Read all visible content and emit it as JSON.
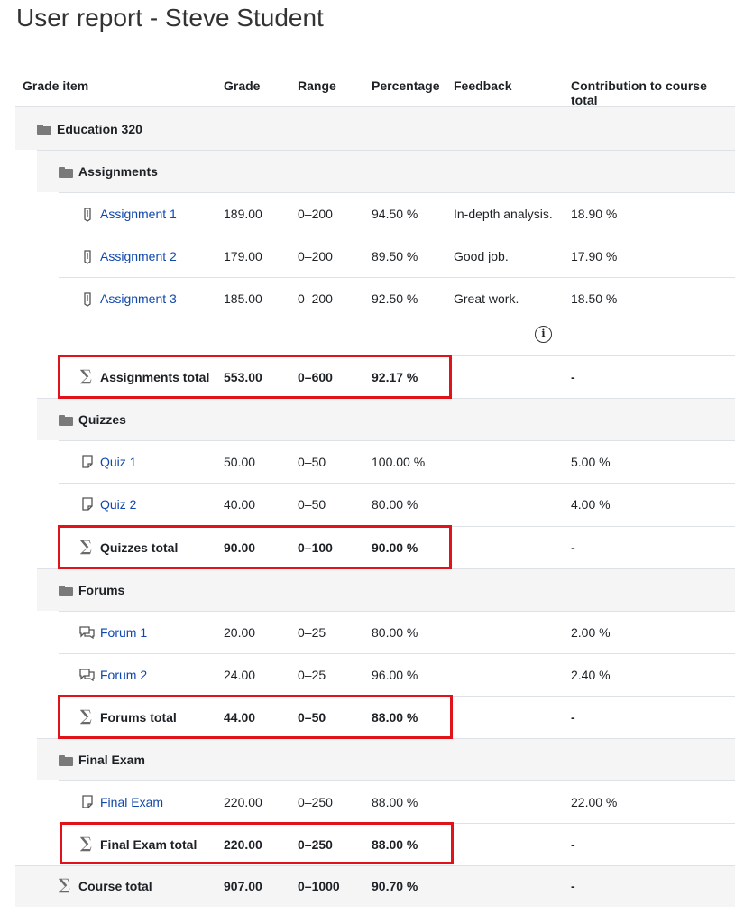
{
  "page": {
    "title": "User report - Steve Student"
  },
  "header": {
    "grade_item": "Grade item",
    "grade": "Grade",
    "range": "Range",
    "percentage": "Percentage",
    "feedback": "Feedback",
    "contribution": "Contribution to course total"
  },
  "course": {
    "name": "Education 320"
  },
  "assignments": {
    "name": "Assignments",
    "items": [
      {
        "name": "Assignment 1",
        "grade": "189.00",
        "range": "0–200",
        "percentage": "94.50 %",
        "feedback": "In-depth analysis.",
        "contribution": "18.90 %"
      },
      {
        "name": "Assignment 2",
        "grade": "179.00",
        "range": "0–200",
        "percentage": "89.50 %",
        "feedback": "Good job.",
        "contribution": "17.90 %"
      },
      {
        "name": "Assignment 3",
        "grade": "185.00",
        "range": "0–200",
        "percentage": "92.50 %",
        "feedback": "Great work.",
        "contribution": "18.50 %"
      }
    ],
    "total": {
      "name": "Assignments total",
      "grade": "553.00",
      "range": "0–600",
      "percentage": "92.17 %",
      "contribution": "-"
    }
  },
  "quizzes": {
    "name": "Quizzes",
    "items": [
      {
        "name": "Quiz 1",
        "grade": "50.00",
        "range": "0–50",
        "percentage": "100.00 %",
        "contribution": "5.00 %"
      },
      {
        "name": "Quiz 2",
        "grade": "40.00",
        "range": "0–50",
        "percentage": "80.00 %",
        "contribution": "4.00 %"
      }
    ],
    "total": {
      "name": "Quizzes total",
      "grade": "90.00",
      "range": "0–100",
      "percentage": "90.00 %",
      "contribution": "-"
    }
  },
  "forums": {
    "name": "Forums",
    "items": [
      {
        "name": "Forum 1",
        "grade": "20.00",
        "range": "0–25",
        "percentage": "80.00 %",
        "contribution": "2.00 %"
      },
      {
        "name": "Forum 2",
        "grade": "24.00",
        "range": "0–25",
        "percentage": "96.00 %",
        "contribution": "2.40 %"
      }
    ],
    "total": {
      "name": "Forums total",
      "grade": "44.00",
      "range": "0–50",
      "percentage": "88.00 %",
      "contribution": "-"
    }
  },
  "final_exam": {
    "name": "Final Exam",
    "items": [
      {
        "name": "Final Exam",
        "grade": "220.00",
        "range": "0–250",
        "percentage": "88.00 %",
        "contribution": "22.00 %"
      }
    ],
    "total": {
      "name": "Final Exam total",
      "grade": "220.00",
      "range": "0–250",
      "percentage": "88.00 %",
      "contribution": "-"
    }
  },
  "course_total": {
    "name": "Course total",
    "grade": "907.00",
    "range": "0–1000",
    "percentage": "90.70 %",
    "contribution": "-"
  },
  "info_icon": {
    "glyph": "i"
  },
  "icons": {
    "assignment": "assignment-icon",
    "quiz": "quiz-icon",
    "forum": "forum-icon",
    "category": "folder-icon",
    "total": "sigma-icon"
  },
  "colors": {
    "link": "#0f47ad",
    "highlight": "#e0131b",
    "row_bg": "#f5f5f5"
  }
}
